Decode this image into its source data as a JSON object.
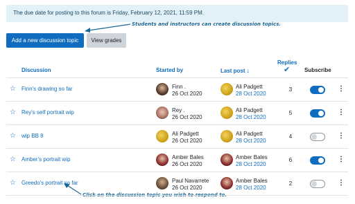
{
  "notice": "The due date for posting to this forum is Friday, February 12, 2021, 11:59 PM.",
  "buttons": {
    "add_topic": "Add a new discussion topic",
    "view_grades": "View grades"
  },
  "annotations": {
    "top": "Students and instructors can create discussion topics.",
    "bottom": "Click on the discussion topic you wish to respond to."
  },
  "table": {
    "headers": {
      "discussion": "Discussion",
      "started_by": "Started by",
      "last_post": "Last post",
      "last_post_sort": "↓",
      "replies": "Replies",
      "replies_check": "✔",
      "subscribe": "Subscribe"
    },
    "rows": [
      {
        "title": "Finn's drawing so far",
        "starter": "Finn .",
        "start_date": "26 Oct 2020",
        "last_by": "Ali Padgett",
        "last_date": "28 Oct 2020",
        "replies": "3",
        "subscribed": true,
        "starter_avatar": "av-dark",
        "last_avatar": "av-gold"
      },
      {
        "title": "Rey's self portrait wip",
        "starter": "Rey .",
        "start_date": "26 Oct 2020",
        "last_by": "Ali Padgett",
        "last_date": "28 Oct 2020",
        "replies": "5",
        "subscribed": true,
        "starter_avatar": "av-pink",
        "last_avatar": "av-gold"
      },
      {
        "title": "wip BB 8",
        "starter": "Ali Padgett",
        "start_date": "26 Oct 2020",
        "last_by": "Ali Padgett",
        "last_date": "28 Oct 2020",
        "replies": "4",
        "subscribed": false,
        "starter_avatar": "av-gold",
        "last_avatar": "av-gold"
      },
      {
        "title": "Amber's portrait wip",
        "starter": "Amber Bales",
        "start_date": "26 Oct 2020",
        "last_by": "Amber Bales",
        "last_date": "28 Oct 2020",
        "replies": "6",
        "subscribed": true,
        "starter_avatar": "av-red",
        "last_avatar": "av-red"
      },
      {
        "title": "Greedo's portrait so far",
        "starter": "Paul Navarrete",
        "start_date": "26 Oct 2020",
        "last_by": "Amber Bales",
        "last_date": "28 Oct 2020",
        "replies": "2",
        "subscribed": false,
        "starter_avatar": "av-brown",
        "last_avatar": "av-red"
      }
    ]
  },
  "icons": {
    "star": "star-outline-icon",
    "menu": "kebab-menu-icon",
    "check": "check-icon",
    "sort": "arrow-down-icon"
  },
  "colors": {
    "accent": "#0f6cbf",
    "notice_bg": "#e2f1f8",
    "annotation": "#1a6696"
  }
}
